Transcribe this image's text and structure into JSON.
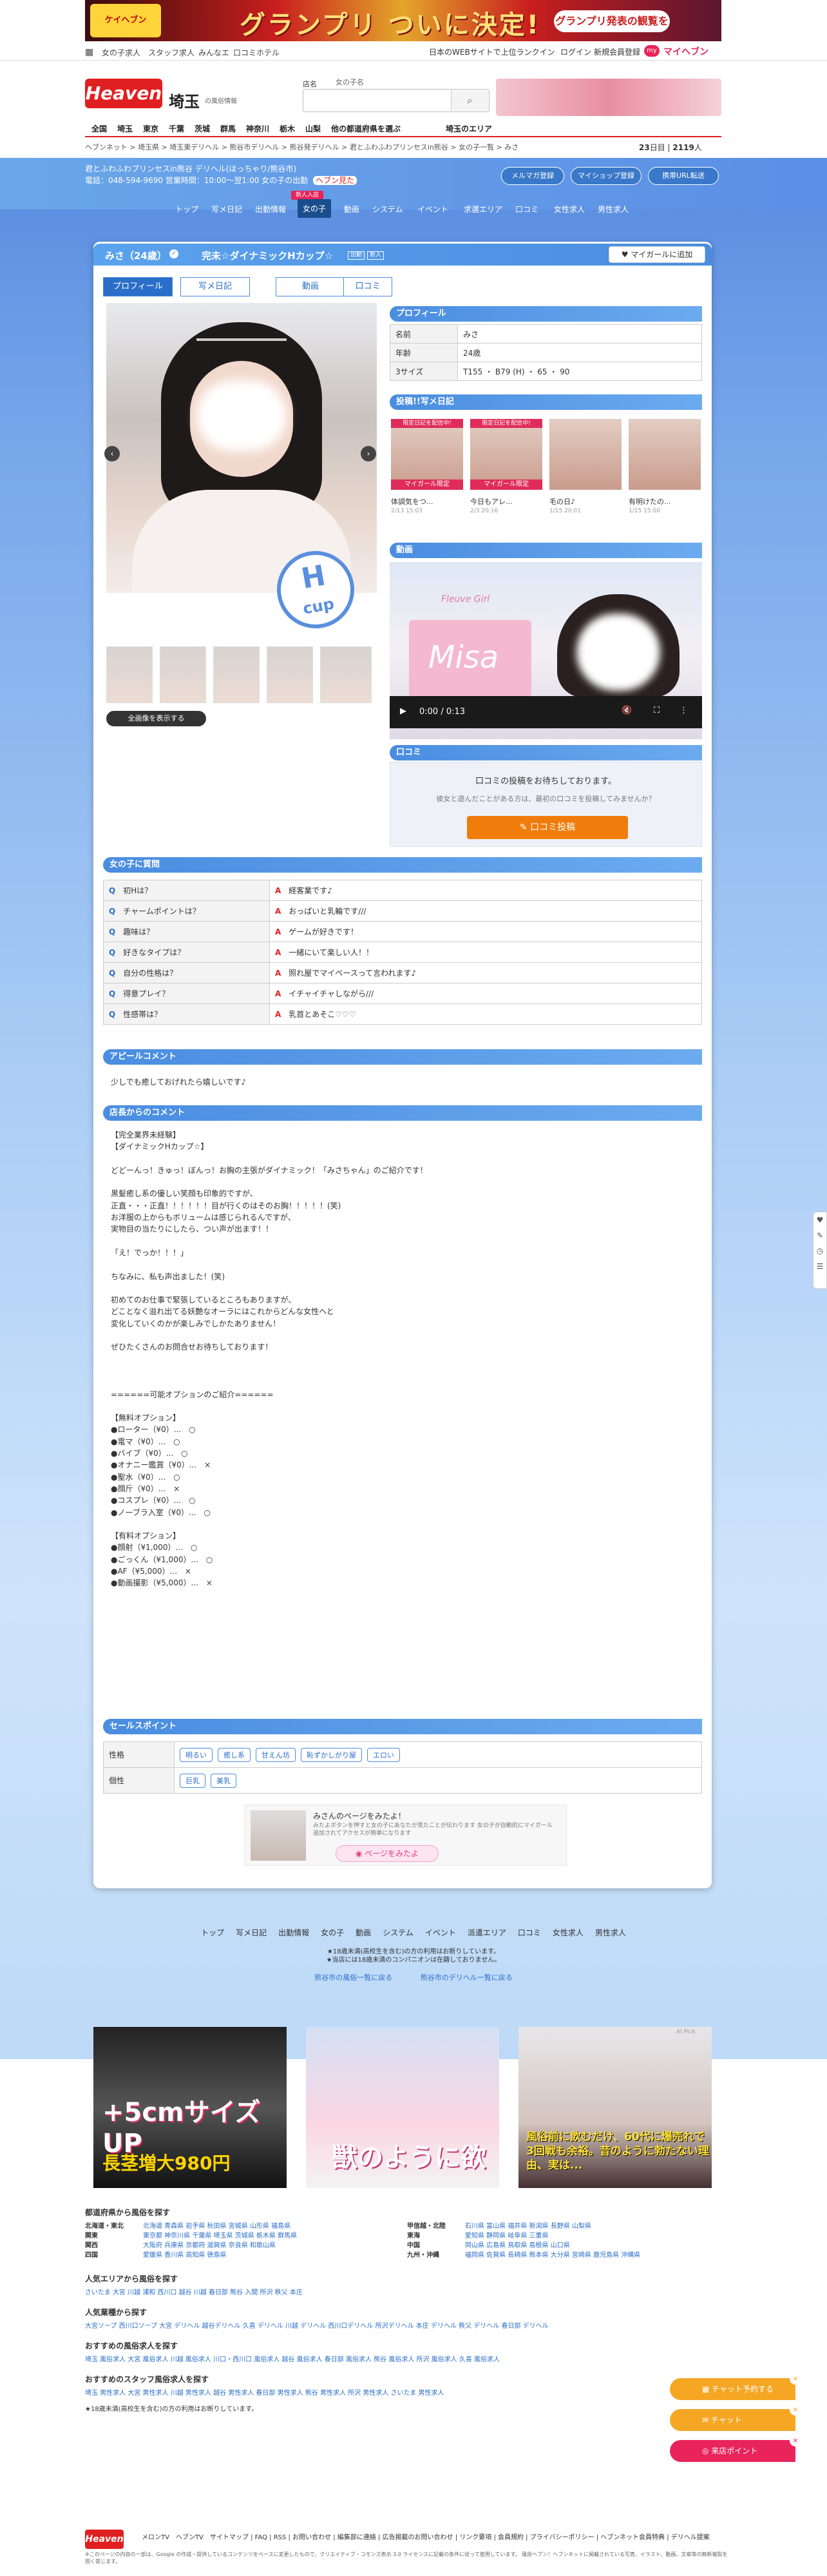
{
  "banner": {
    "left": "ケイヘブン",
    "title": "グランプリ ついに決定!",
    "right": "グランプリ発表の観覧を"
  },
  "topnav": {
    "left": [
      "女の子求人",
      "スタッフ求人",
      "みんなエ",
      "口コミホテル"
    ],
    "right": [
      "日本のWEBサイトで上位ランクイン",
      "ログイン",
      "新規会員登録"
    ],
    "brand": "マイヘブン",
    "my": "my"
  },
  "header": {
    "logo": "Heaven",
    "region": "埼玉",
    "region_sub": "の風俗情報",
    "search_label": "店名",
    "search_placeholder": "女の子名",
    "search_icon": "search-icon"
  },
  "areanav": [
    "全国",
    "埼玉",
    "東京",
    "千葉",
    "茨城",
    "群馬",
    "神奈川",
    "栃木",
    "山梨",
    "他の都道府県を選ぶ",
    "埼玉のエリア"
  ],
  "breadcrumb": "ヘブンネット > 埼玉県 > 埼玉東デリヘル > 熊谷市デリヘル > 熊谷発デリヘル > 君とふわふわプリンセスin熊谷 > 女の子一覧 > みさ",
  "rate": {
    "today": "23",
    "today_unit": "日目",
    "count": "2119",
    "count_unit": "人"
  },
  "shop": {
    "line1": "君とふわふわプリンセスin熊谷 デリヘル(ほっちゃり/熊谷市)",
    "line2": "電話：048-594-9690 営業時間：10:00〜翌1:00 女の子の出勤",
    "new_tag": "ヘブン見た",
    "buttons": [
      "メルマガ登録",
      "マイショップ登録",
      "携帯URL転送"
    ],
    "nav": [
      "トップ",
      "写メ日記",
      "出勤情報",
      "女の子",
      "動画",
      "システム",
      "イベント",
      "求選エリア",
      "口コミ",
      "女性求人",
      "男性求人"
    ],
    "new_badge": "新人入店"
  },
  "girl": {
    "name": "みさ（24歳）",
    "catch": "完未☆ダイナミックHカップ☆",
    "tag1": "出勤",
    "tag2": "新人",
    "fav": "マイガールに追加"
  },
  "tabs": [
    "プロフィール",
    "写メ日記",
    "動画",
    "口コミ"
  ],
  "photo": {
    "cup": "H",
    "cup_label": "cup",
    "prev": "‹",
    "next": "›",
    "all_images": "全画像を表示する"
  },
  "profile": {
    "title": "プロフィール",
    "rows": [
      [
        "名前",
        "みさ"
      ],
      [
        "年齢",
        "24歳"
      ],
      [
        "3サイズ",
        "T155 ・ B79 (H) ・ 65 ・ 90"
      ]
    ]
  },
  "diary": {
    "title": "投稿!!写メ日記",
    "items": [
      {
        "badge": "限定日記を配信中!",
        "tag": "マイガール限定",
        "title": "体調気をつ...",
        "date": "2/13 15:03"
      },
      {
        "badge": "限定日記を配信中!",
        "tag": "マイガール限定",
        "title": "今日もアレ...",
        "date": "2/3 20:16"
      },
      {
        "badge": "",
        "tag": "",
        "title": "毛の日♪",
        "date": "1/15 20:01"
      },
      {
        "badge": "",
        "tag": "",
        "title": "有明けたの...",
        "date": "1/15 15:00"
      }
    ]
  },
  "video": {
    "title": "動画",
    "label_girl": "Fleuve Girl",
    "label_name": "Misa",
    "time": "0:00 / 0:13"
  },
  "review": {
    "title": "口コミ",
    "line1": "口コミの投稿をお待ちしております。",
    "line2": "彼女と遊んだことがある方は、最初の口コミを投稿してみませんか？",
    "button": "✎ 口コミ投稿"
  },
  "qa": {
    "title": "女の子に質問",
    "rows": [
      [
        "初Hは？",
        "経客業です♪"
      ],
      [
        "チャームポイントは？",
        "おっぱいと乳輪です///"
      ],
      [
        "趣味は？",
        "ゲームが好きです！"
      ],
      [
        "好きなタイプは？",
        "一緒にいて楽しい人！！"
      ],
      [
        "自分の性格は？",
        "照れ屋でマイペースって言われます♪"
      ],
      [
        "得意プレイ？",
        "イチャイチャしながら///"
      ],
      [
        "性感帯は？",
        "乳首とあそこ♡♡♡"
      ]
    ]
  },
  "appeal": {
    "title": "アピールコメント",
    "text": "少しでも癒しておげれたら嬉しいです♪"
  },
  "comment": {
    "title": "店長からのコメント",
    "text": "【完全業界未経験】\n【ダイナミックHカップ☆】\n\nどどーんっ！きゅっ！ぼんっ！お胸の主張がダイナミック！「みさちゃん」のご紹介です！\n\n黒髪癒し系の優しい笑顔も印象的ですが、\n正直・・・正直！！！！！！目が行くのはそのお胸！！！！！(笑)\nお洋服の上からもボリュームは感じられるんですが、\n実物目の当たりにしたら、つい声が出ます！！\n\n「え！でっか！！！」\n\nちなみに、私も声出ました！(笑)\n\n初めてのお仕事で緊張しているところもありますが、\nどことなく溢れ出てる妖艶なオーラにはこれからどんな女性へと\n変化していくのかが楽しみでしかたありません！\n\nぜひたくさんのお問合せお待ちしております！\n\n\n\n======可能オプションのご紹介======\n\n【無料オプション】\n●ローター（¥0）...　○\n●電マ（¥0）...　○\n●バイブ（¥0）...　○\n●オナニー鑑賞（¥0）...　×\n●聖水（¥0）...　○\n●顔斤（¥0）...　×\n●コスプレ（¥0）...　○\n●ノーブラ入室（¥0）...　○\n\n【有料オプション】\n●顔射（¥1,000）...　○\n●ごっくん（¥1,000）...　○\n●AF（¥5,000）...　×\n●動画撮影（¥5,000）...　×"
  },
  "sales": {
    "title": "セールスポイント",
    "rows": [
      {
        "k": "性格",
        "v": [
          "明るい",
          "癒し系",
          "甘えん坊",
          "恥ずかしがり屋",
          "エロい"
        ]
      },
      {
        "k": "個性",
        "v": [
          "巨乳",
          "美乳"
        ]
      }
    ]
  },
  "visit": {
    "t1": "みさんのページをみたよ！",
    "t2": "みたよボタンを押すと女の子にあなたが見たことが伝わります 女の子が自動的にマイガール追加されてアクセスが簡単になります",
    "button": "ページをみたよ"
  },
  "footnav": [
    "トップ",
    "写メ日記",
    "出勤情報",
    "女の子",
    "動画",
    "システム",
    "イベント",
    "派遣エリア",
    "口コミ",
    "女性求人",
    "男性求人"
  ],
  "footnote": [
    "★18歳未満(高校生を含む)の方の利用はお断りしています。",
    "★当店には18歳未満のコンパニオンは在籍しておりません。"
  ],
  "footnote2": [
    "熊谷市の風俗一覧に戻る",
    "熊谷市のデリヘル一覧に戻る"
  ],
  "ads": [
    {
      "t": "+5cmサイズUP",
      "t2": "長茎増大980円"
    },
    {
      "t": "獣のように欲"
    },
    {
      "t": "風俗前に飲むだけ、60代に爆売れで3回戦も余裕。昔のように勃たない理由、実は..."
    }
  ],
  "ad_tag": "AI Pick",
  "links": {
    "h1": "都道府県から風俗を探す",
    "rows": [
      [
        "北海道・東北",
        "北海道 青森県 岩手県 秋田県 宮城県 山形県 福島県"
      ],
      [
        "関東",
        "東京都 神奈川県 千葉県 埼玉県 茨城県 栃木県 群馬県"
      ],
      [
        "関西",
        "大阪府 兵庫県 京都府 滋賀県 奈良県 和歌山県"
      ],
      [
        "四国",
        "愛媛県 香川県 高知県 徳島県"
      ],
      [
        "甲信越・北陸",
        "石川県 富山県 福井県 新潟県 長野県 山梨県"
      ],
      [
        "東海",
        "愛知県 静岡県 岐阜県 三重県"
      ],
      [
        "中国",
        "岡山県 広島県 鳥取県 島根県 山口県"
      ],
      [
        "九州・沖縄",
        "福岡県 佐賀県 長崎県 熊本県 大分県 宮崎県 鹿児島県 沖縄県"
      ]
    ],
    "h2": "人気エリアから風俗を探す",
    "r2": "さいたま 大宮 川越 浦和 西川口 越谷 川越 春日部 熊谷 入間 所沢 秩父 本庄",
    "h3": "人気業種から探す",
    "r3": "大宮ソープ 西川口ソープ 大宮 デリヘル 越谷デリヘル 久喜 デリヘル 川越 デリヘル 西川口デリヘル 所沢デリヘル 本庄 デリヘル 秩父 デリヘル 春日部 デリヘル",
    "h4": "おすすめの風俗求人を探す",
    "r4": "埼玉 風俗求人 大宮 風俗求人 川越 風俗求人 川口・西川口 風俗求人 越谷 風俗求人 春日部 風俗求人 熊谷 風俗求人 所沢 風俗求人 久喜 風俗求人",
    "h5": "おすすめのスタッフ風俗求人を探す",
    "r5": "埼玉 男性求人 大宮 男性求人 川越 男性求人 越谷 男性求人 春日部 男性求人 熊谷 男性求人 所沢 男性求人 さいたま 男性求人",
    "note": "★18歳未満(高校生を含む)の方の利用はお断りしています。"
  },
  "footer": {
    "logo": "Heaven",
    "links": "メロンTV　ヘブンTV　サイトマップ | FAQ | RSS | お問い合わせ | 編集部に連絡 | 広告掲載のお問い合わせ | リンク要項 | 会員規約 | プライバシーポリシー | ヘブンネット会員特典 | デリヘル提案",
    "copy": "※このページの内容の一部は、Google の作成・提供しているコンテンツをベースに変更したもので、クリエイティブ・コモンズ表示 3.0 ライセンスに記載の条件に従って使用しています。 風俗ヘブン！ヘブンネットに掲載されている写真、イラスト、動画、文章等の無断複製を固く禁じます。"
  },
  "floats": [
    "チャット予約する",
    "チャット",
    "来店ポイント"
  ],
  "side": [
    "♥",
    "✎",
    "◷",
    "☰"
  ]
}
